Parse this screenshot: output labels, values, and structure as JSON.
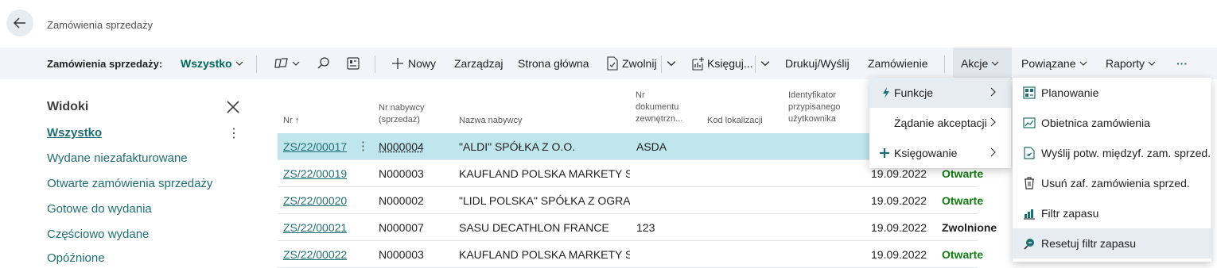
{
  "header": {
    "page_title": "Zamówienia sprzedaży"
  },
  "actionbar": {
    "view_label": "Zamówienia sprzedaży:",
    "view_value": "Wszystko",
    "new_label": "Nowy",
    "manage_label": "Zarządzaj",
    "home_label": "Strona główna",
    "release_label": "Zwolnij",
    "post_label": "Księguj...",
    "print_label": "Drukuj/Wyślij",
    "order_label": "Zamówienie",
    "actions_label": "Akcje",
    "related_label": "Powiązane",
    "reports_label": "Raporty",
    "more_label": "···"
  },
  "views": {
    "title": "Widoki",
    "items": [
      "Wszystko",
      "Wydane niezafakturowane",
      "Otwarte zamówienia sprzedaży",
      "Gotowe do wydania",
      "Częściowo wydane",
      "Opóźnione"
    ]
  },
  "table": {
    "headers": {
      "no": "Nr ↑",
      "buyer_no_1": "Nr nabywcy",
      "buyer_no_2": "(sprzedaż)",
      "buyer_name": "Nazwa nabywcy",
      "ext_doc_1": "Nr",
      "ext_doc_2": "dokumentu",
      "ext_doc_3": "zewnętrzn...",
      "location": "Kod lokalizacji",
      "assigned_1": "Identyfikator",
      "assigned_2": "przypisanego",
      "assigned_3": "użytkownika"
    },
    "rows": [
      {
        "no": "ZS/22/00017",
        "buyer_no": "N000004",
        "buyer_name": "\"ALDI\" SPÓŁKA Z O.O.",
        "ext_doc": "ASDA",
        "date": "",
        "status": ""
      },
      {
        "no": "ZS/22/00019",
        "buyer_no": "N000003",
        "buyer_name": "KAUFLAND POLSKA MARKETY S...",
        "ext_doc": "",
        "date": "19.09.2022",
        "status": "Otwarte"
      },
      {
        "no": "ZS/22/00020",
        "buyer_no": "N000002",
        "buyer_name": "\"LIDL POLSKA\" SPÓŁKA Z OGRA...",
        "ext_doc": "",
        "date": "19.09.2022",
        "status": "Otwarte"
      },
      {
        "no": "ZS/22/00021",
        "buyer_no": "N000007",
        "buyer_name": "SASU DECATHLON FRANCE",
        "ext_doc": "123",
        "date": "19.09.2022",
        "status": "Zwolnione"
      },
      {
        "no": "ZS/22/00022",
        "buyer_no": "N000003",
        "buyer_name": "KAUFLAND POLSKA MARKETY S...",
        "ext_doc": "",
        "date": "19.09.2022",
        "status": "Otwarte"
      }
    ]
  },
  "actions_menu": {
    "items": [
      "Funkcje",
      "Żądanie akceptacji",
      "Księgowanie"
    ]
  },
  "functions_submenu": {
    "items": [
      "Planowanie",
      "Obietnica zamówienia",
      "Wyślij potw. międzyf. zam. sprzed.",
      "Usuń zaf. zamówienia sprzed.",
      "Filtr zapasu",
      "Resetuj filtr zapasu"
    ]
  },
  "colors": {
    "accent": "#00695c",
    "link": "#1f6e74",
    "selected_row": "#bfe6ec",
    "status_open": "#107c10"
  }
}
